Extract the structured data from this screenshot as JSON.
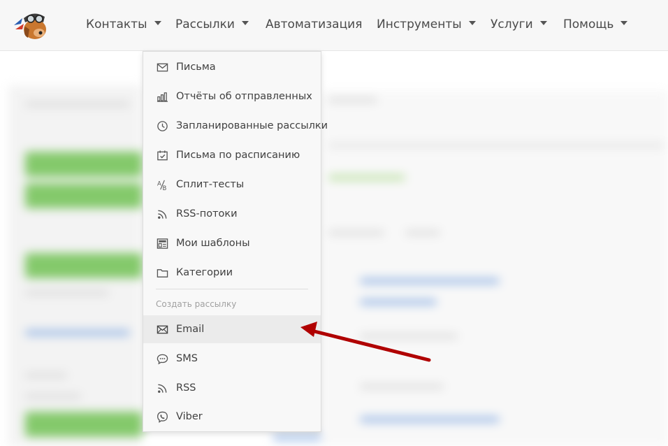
{
  "navbar": {
    "items": [
      {
        "label": "Контакты",
        "has_caret": true
      },
      {
        "label": "Рассылки",
        "has_caret": true
      },
      {
        "label": "Автоматизация",
        "has_caret": false
      },
      {
        "label": "Инструменты",
        "has_caret": true
      },
      {
        "label": "Услуги",
        "has_caret": true
      },
      {
        "label": "Помощь",
        "has_caret": true
      }
    ]
  },
  "dropdown": {
    "items": [
      {
        "label": "Письма",
        "icon": "envelope-icon"
      },
      {
        "label": "Отчёты об отправленных",
        "icon": "bar-chart-icon"
      },
      {
        "label": "Запланированные рассылки",
        "icon": "clock-icon"
      },
      {
        "label": "Письма по расписанию",
        "icon": "calendar-check-icon"
      },
      {
        "label": "Сплит-тесты",
        "icon": "ab-test-icon"
      },
      {
        "label": "RSS-потоки",
        "icon": "rss-icon"
      },
      {
        "label": "Мои шаблоны",
        "icon": "template-icon"
      },
      {
        "label": "Категории",
        "icon": "folder-icon"
      }
    ],
    "create_header": "Создать рассылку",
    "create_items": [
      {
        "label": "Email",
        "icon": "envelope-icon",
        "active": true
      },
      {
        "label": "SMS",
        "icon": "sms-bubble-icon"
      },
      {
        "label": "RSS",
        "icon": "rss-icon"
      },
      {
        "label": "Viber",
        "icon": "viber-icon"
      }
    ]
  },
  "colors": {
    "navbar_bg": "#f7f7f7",
    "dropdown_bg": "#f8f8f8",
    "active_item_bg": "#ebebeb",
    "annotation_arrow": "#b00000",
    "background_green": "#84c96b"
  }
}
